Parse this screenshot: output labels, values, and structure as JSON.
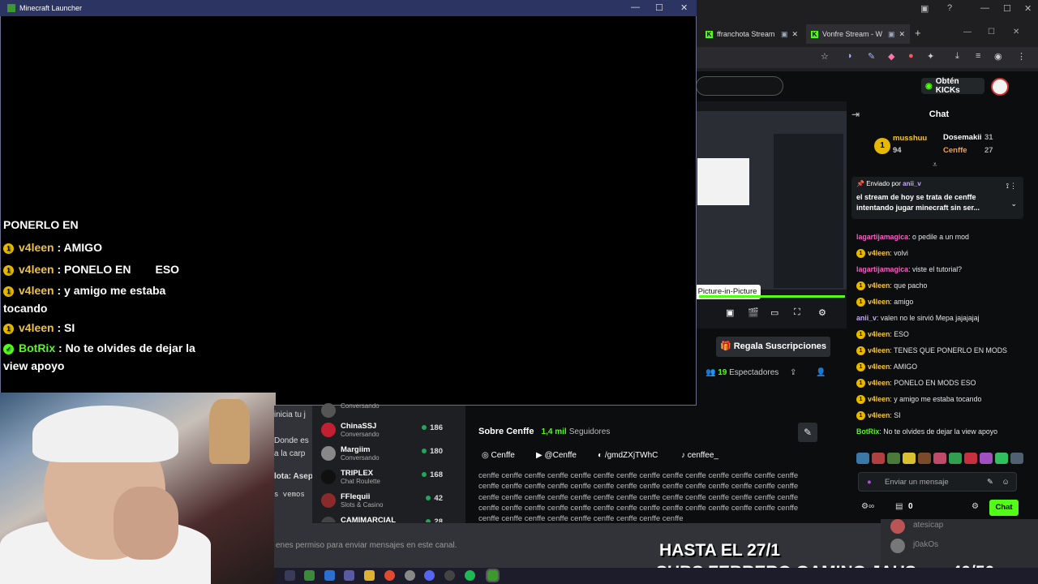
{
  "launcher": {
    "title": "Minecraft Launcher",
    "minimize": "—",
    "maximize": "☐",
    "close": "✕"
  },
  "overlay_chat": [
    {
      "user": "",
      "text": "PONERLO EN"
    },
    {
      "user": "v4leen",
      "text": ": AMIGO"
    },
    {
      "user": "v4leen",
      "text": ": PONELO EN",
      "tail": "ESO"
    },
    {
      "user": "v4leen",
      "text": ": y amigo me estaba tocando"
    },
    {
      "user": "v4leen",
      "text": ": SI"
    },
    {
      "user": "BotRix",
      "text": ": No te olvides de dejar la view apoyo"
    }
  ],
  "browser": {
    "tabs": [
      {
        "label": "ffranchota Stream"
      },
      {
        "label": "Vonfre Stream - W"
      }
    ],
    "new_tab": "+"
  },
  "kick": {
    "get_kicks": "Obtén KICKs",
    "chat_title": "Chat",
    "leaderboard": [
      {
        "name": "musshuu",
        "count": "94"
      },
      {
        "name": "Dosemakii",
        "count": "31"
      },
      {
        "name": "Cenffe",
        "count": "27"
      }
    ],
    "pinned_by_label": "Enviado por",
    "pinned_by": "anii_v",
    "pinned_text": "el stream de hoy se trata de cenffe intentando jugar minecraft sin ser...",
    "messages": [
      {
        "user": "lagartijamagica",
        "text": ": o pedile a un mod",
        "color": "#ff5cc8"
      },
      {
        "user": "v4leen",
        "text": ": volvi",
        "color": "#f5c542"
      },
      {
        "user": "lagartijamagica",
        "text": ": viste el tutorial?",
        "color": "#ff5cc8"
      },
      {
        "user": "v4leen",
        "text": ": que pacho",
        "color": "#f5c542"
      },
      {
        "user": "v4leen",
        "text": ": amigo",
        "color": "#f5c542"
      },
      {
        "user": "anii_v",
        "text": ": valen no le sirvió Mepa jajajajaj",
        "color": "#c8a8ff"
      },
      {
        "user": "v4leen",
        "text": ": ESO",
        "color": "#f5c542"
      },
      {
        "user": "v4leen",
        "text": ": TENES QUE PONERLO EN MODS",
        "color": "#f5c542"
      },
      {
        "user": "v4leen",
        "text": ": AMIGO",
        "color": "#f5c542"
      },
      {
        "user": "v4leen",
        "text": ": PONELO EN MODS ESO",
        "color": "#f5c542"
      },
      {
        "user": "v4leen",
        "text": ": y amigo me estaba tocando",
        "color": "#f5c542"
      },
      {
        "user": "v4leen",
        "text": ": SI",
        "color": "#f5c542"
      },
      {
        "user": "BotRix",
        "text": ": No te olvides de dejar la view apoyo",
        "color": "#53fc18"
      }
    ],
    "input_placeholder": "Enviar un mensaje",
    "points": "0",
    "send_label": "Chat",
    "pip_tooltip": "Picture-in-Picture",
    "gift_subs": "Regala Suscripciones",
    "viewers_count": "19",
    "viewers_label": "Espectadores",
    "about_title": "Sobre Cenffe",
    "followers": "1,4 mil",
    "followers_label": "Seguidores",
    "socials": [
      "Cenffe",
      "@Cenffe",
      "/gmdZXjTWhC",
      "cenffee_"
    ],
    "about_text": "cenffe cenffe cenffe cenffe cenffe cenffe cenffe cenffe cenffe cenffe cenffe cenffe cenffe cenffe cenffe cenffe cenffe cenffe cenffe cenffe cenffe cenffe cenffe cenffe cenffe cenffe cenffe cenffe cenffe cenffe cenffe cenffe cenffe cenffe cenffe cenffe cenffe cenffe cenffe cenffe cenffe cenffe cenffe cenffe cenffe cenffe cenffe cenffe cenffe cenffe cenffe cenffe cenffe cenffe cenffe cenffe cenffe cenffe cenffe cenffe cenffe cenffe cenffe cenffe cenffe"
  },
  "discord": {
    "members": [
      {
        "name": "",
        "status": "Conversando",
        "count": ""
      },
      {
        "name": "ChinaSSJ",
        "status": "Conversando",
        "count": "186"
      },
      {
        "name": "Margiim",
        "status": "Conversando",
        "count": "180"
      },
      {
        "name": "TRIPLEX",
        "status": "Chat Roulette",
        "count": "168"
      },
      {
        "name": "FFlequii",
        "status": "Slots & Casino",
        "count": "42"
      },
      {
        "name": "CAMIMARCIAL",
        "status": "",
        "count": "28"
      }
    ],
    "snippets": [
      "inicia tu j",
      "Donde es",
      "a la carp",
      "lota: Asep",
      "s vemos"
    ],
    "no_permission": "enes permiso para enviar mensajes en este canal.",
    "side_users": [
      "atesicap",
      "j0akOs"
    ]
  },
  "overlay_big": {
    "line1": "HASTA EL 27/1",
    "line2": "SUBS FEBRERO GAMING JAUS",
    "count": "40/50"
  },
  "colors": {
    "kick_green": "#53fc18",
    "launcher_title": "#2c3462"
  }
}
